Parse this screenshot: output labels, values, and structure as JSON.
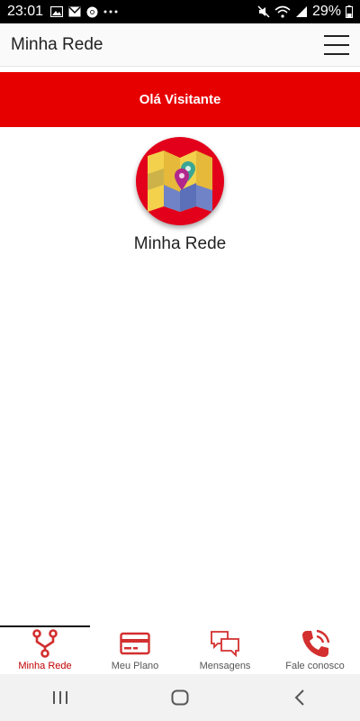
{
  "status_bar": {
    "time": "23:01",
    "battery": "29%",
    "left_icons": [
      "image-icon",
      "gmail-icon",
      "chrome-icon",
      "more-dots-icon"
    ],
    "right_icons": [
      "mute-icon",
      "wifi-icon",
      "signal-icon",
      "battery-icon"
    ]
  },
  "app_bar": {
    "title": "Minha Rede",
    "menu_icon": "hamburger-menu-icon"
  },
  "banner": {
    "text": "Olá Visitante",
    "color": "#e60000"
  },
  "feature": {
    "label": "Minha Rede",
    "icon": "map-pin-icon"
  },
  "bottom_nav": {
    "items": [
      {
        "label": "Minha Rede",
        "icon": "network-icon",
        "active": true
      },
      {
        "label": "Meu Plano",
        "icon": "credit-card-icon",
        "active": false
      },
      {
        "label": "Mensagens",
        "icon": "messages-icon",
        "active": false
      },
      {
        "label": "Fale conosco",
        "icon": "phone-icon",
        "active": false
      }
    ],
    "accent": "#d32f2f"
  },
  "system_nav": {
    "buttons": [
      "recents-icon",
      "home-icon",
      "back-icon"
    ]
  }
}
